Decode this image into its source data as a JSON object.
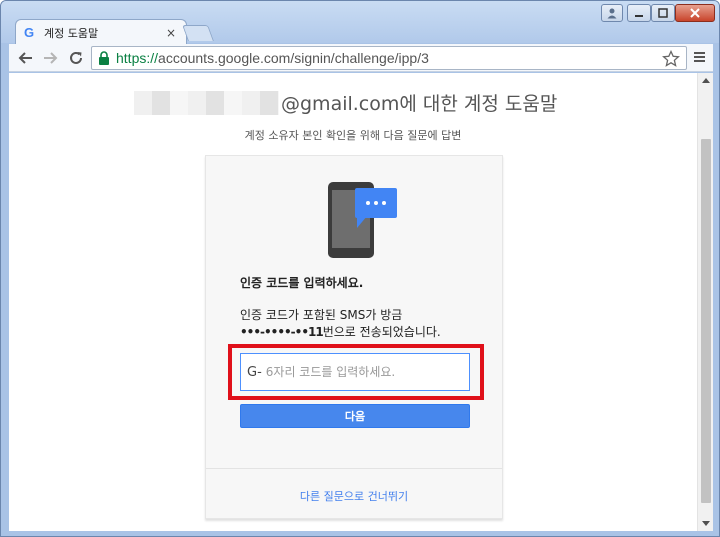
{
  "browser": {
    "tab": {
      "favicon": "G",
      "title": "계정 도움말",
      "close_label": "×"
    },
    "address_bar": {
      "scheme": "https://",
      "rest": "accounts.google.com/signin/challenge/ipp/3"
    },
    "icons": [
      "back-arrow-icon",
      "forward-arrow-icon",
      "reload-icon",
      "lock-icon",
      "star-icon",
      "menu-icon"
    ],
    "colors": {
      "secure_url": "#0b8043",
      "frame": "#b1c9ea"
    }
  },
  "page": {
    "title": "@gmail.com에 대한 계정 도움말",
    "subtitle": "계정 소유자 본인 확인을 위해 다음 질문에 답변",
    "card": {
      "heading": "인증 코드를 입력하세요.",
      "body_line1": "인증 코드가 포함된 SMS가 방금",
      "masked_phone": "•••-••••-••11",
      "body_line2_suffix": "번으로 전송되었습니다.",
      "code_prefix": "G-",
      "code_placeholder": "6자리 코드를 입력하세요.",
      "code_value": "",
      "next_button": "다음",
      "skip_link": "다른 질문으로 건너뛰기"
    },
    "colors": {
      "button": "#4787ed",
      "highlight": "#e0101a",
      "link": "#427fed",
      "phone_bubble": "#4285f4"
    }
  }
}
